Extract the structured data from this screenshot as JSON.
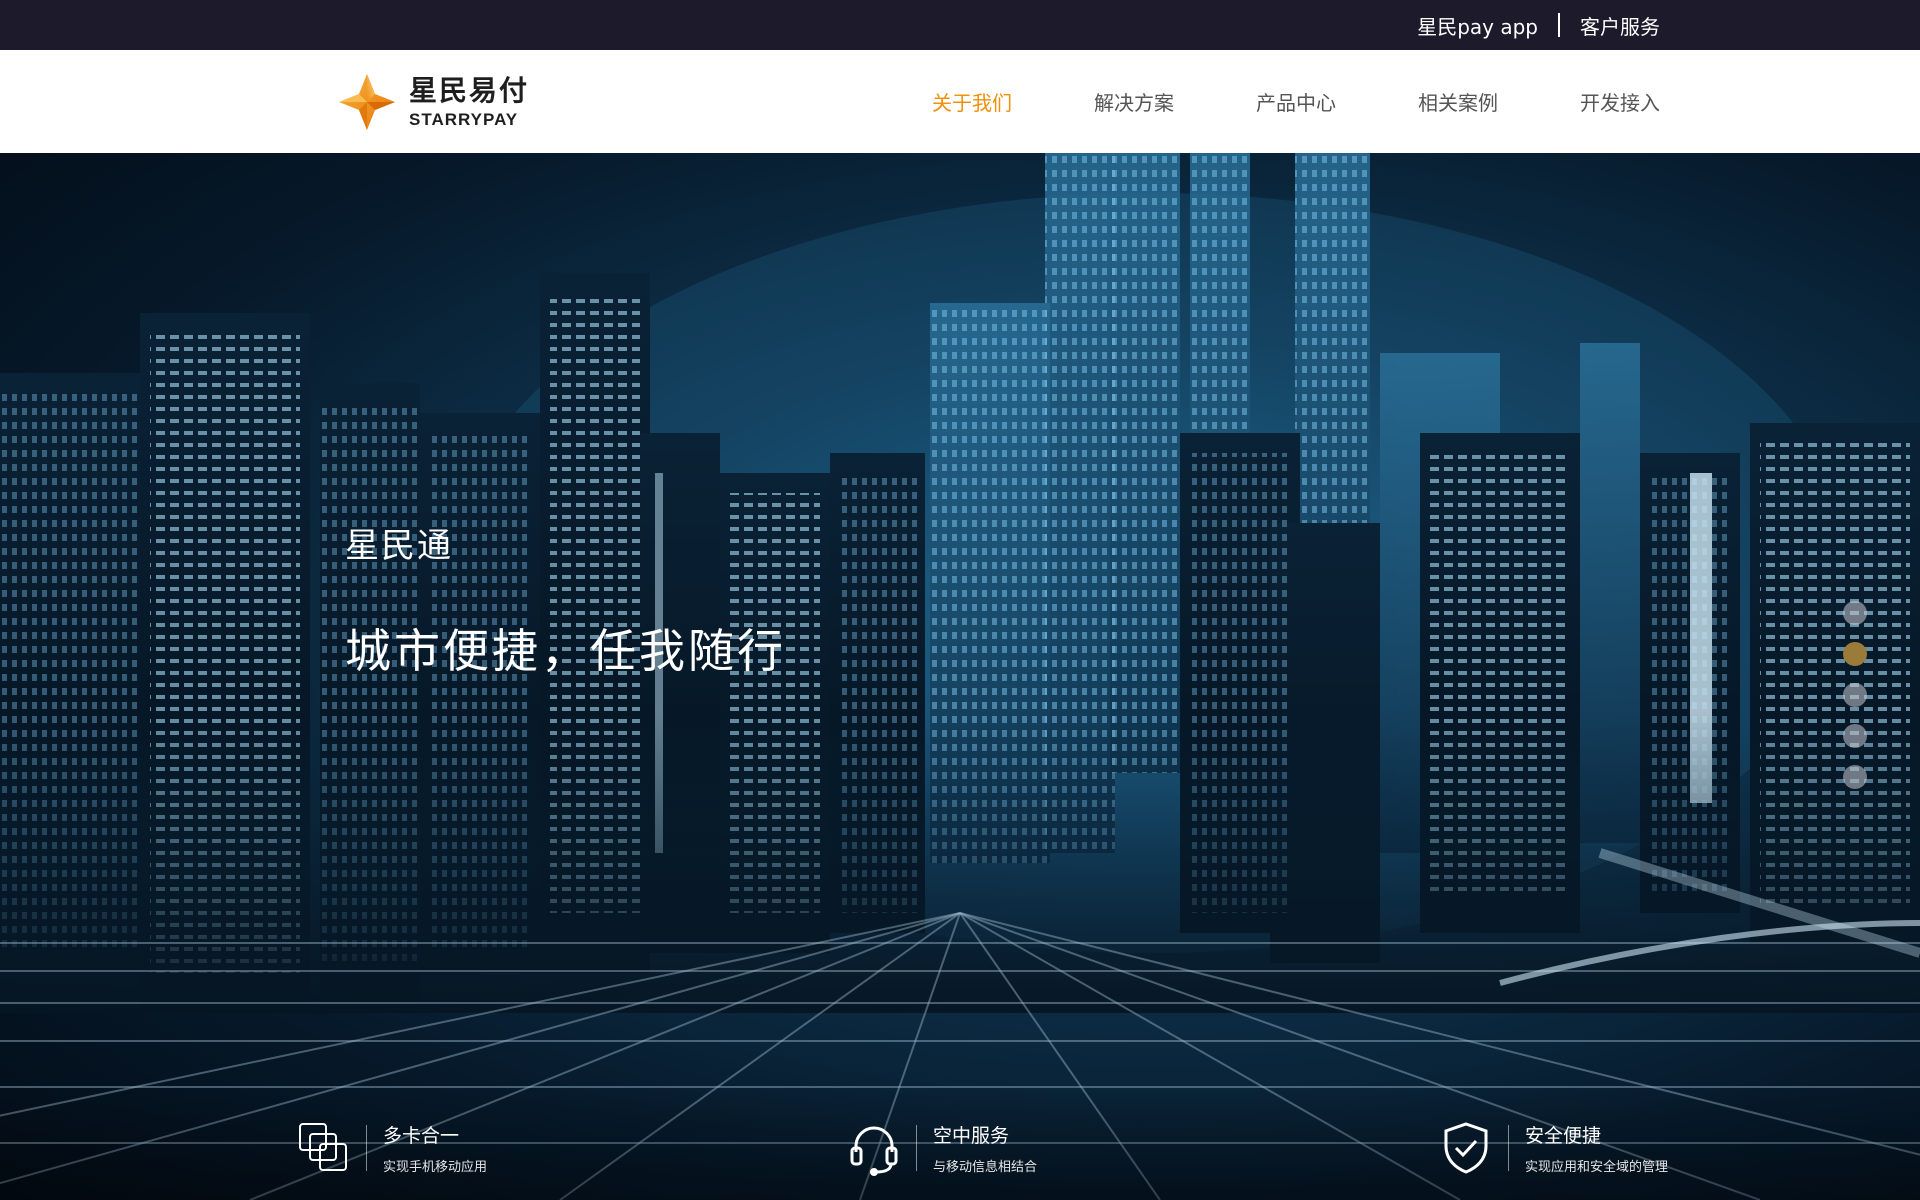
{
  "topbar": {
    "app_link": "星民pay app",
    "service_link": "客户服务"
  },
  "logo": {
    "cn": "星民易付",
    "en": "STARRYPAY"
  },
  "nav": {
    "items": [
      {
        "label": "关于我们",
        "active": true
      },
      {
        "label": "解决方案",
        "active": false
      },
      {
        "label": "产品中心",
        "active": false
      },
      {
        "label": "相关案例",
        "active": false
      },
      {
        "label": "开发接入",
        "active": false
      }
    ]
  },
  "hero": {
    "subtitle": "星民通",
    "title": "城市便捷，任我随行",
    "slide_count": 5,
    "active_slide": 2
  },
  "features": [
    {
      "icon": "cards-icon",
      "title": "多卡合一",
      "desc": "实现手机移动应用"
    },
    {
      "icon": "headset-icon",
      "title": "空中服务",
      "desc": "与移动信息相结合"
    },
    {
      "icon": "shield-check-icon",
      "title": "安全便捷",
      "desc": "实现应用和安全域的管理"
    }
  ],
  "colors": {
    "accent": "#f0900c",
    "topbar": "#1c1a2b",
    "dot_active": "#9b7b3a"
  }
}
